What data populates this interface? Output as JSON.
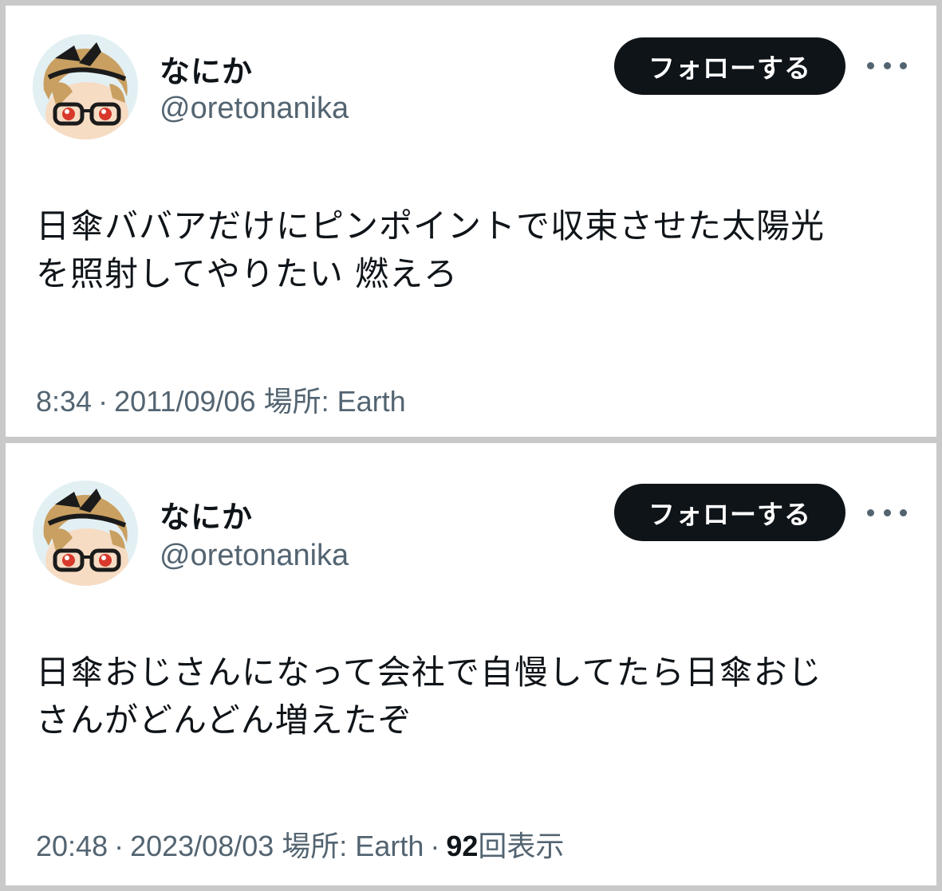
{
  "tweets": [
    {
      "display_name": "なにか",
      "handle": "@oretonanika",
      "follow_label": "フォローする",
      "text": "日傘ババアだけにピンポイントで収束させた太陽光\nを照射してやりたい  燃えろ",
      "time": "8:34",
      "date": "2011/09/06",
      "location_label": "場所: Earth",
      "views_count": "",
      "views_label": ""
    },
    {
      "display_name": "なにか",
      "handle": "@oretonanika",
      "follow_label": "フォローする",
      "text": "日傘おじさんになって会社で自慢してたら日傘おじ\nさんがどんどん増えたぞ",
      "time": "20:48",
      "date": "2023/08/03",
      "location_label": "場所: Earth",
      "views_count": "92",
      "views_label": "回表示"
    }
  ],
  "meta_separator": "·",
  "icons": {
    "more": "more-horizontal-icon",
    "avatar": "avatar-image"
  },
  "colors": {
    "text": "#0f1419",
    "secondary": "#536471",
    "button_bg": "#0f1419",
    "button_text": "#ffffff",
    "card_bg": "#ffffff",
    "border": "#c9c9c9"
  }
}
